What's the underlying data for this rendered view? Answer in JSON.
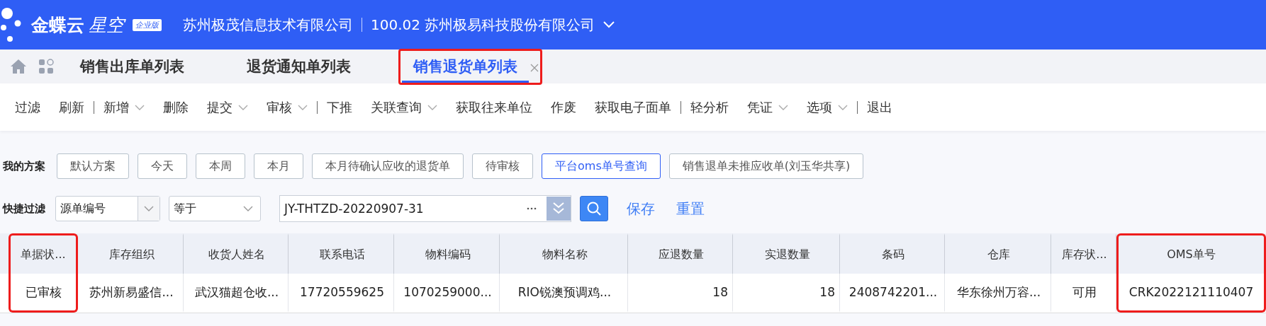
{
  "header": {
    "logo_text": "金蝶云",
    "logo_subtext": "星空",
    "edition_badge": "企业版",
    "company": "苏州极茂信息技术有限公司",
    "org": "100.02 苏州极易科技股份有限公司"
  },
  "tabs": [
    {
      "label": "销售出库单列表",
      "selected": false,
      "highlighted": false,
      "closable": false
    },
    {
      "label": "退货通知单列表",
      "selected": false,
      "highlighted": false,
      "closable": false
    },
    {
      "label": "销售退货单列表",
      "selected": true,
      "highlighted": true,
      "closable": true
    }
  ],
  "toolbar": [
    {
      "label": "过滤",
      "dropdown": false,
      "separator_after": false
    },
    {
      "label": "刷新",
      "dropdown": false,
      "separator_after": true
    },
    {
      "label": "新增",
      "dropdown": true,
      "separator_after": false
    },
    {
      "label": "删除",
      "dropdown": false,
      "separator_after": false
    },
    {
      "label": "提交",
      "dropdown": true,
      "separator_after": false
    },
    {
      "label": "审核",
      "dropdown": true,
      "separator_after": true
    },
    {
      "label": "下推",
      "dropdown": false,
      "separator_after": false
    },
    {
      "label": "关联查询",
      "dropdown": true,
      "separator_after": false
    },
    {
      "label": "获取往来单位",
      "dropdown": false,
      "separator_after": false
    },
    {
      "label": "作废",
      "dropdown": false,
      "separator_after": false
    },
    {
      "label": "获取电子面单",
      "dropdown": false,
      "separator_after": true
    },
    {
      "label": "轻分析",
      "dropdown": false,
      "separator_after": false
    },
    {
      "label": "凭证",
      "dropdown": true,
      "separator_after": false
    },
    {
      "label": "选项",
      "dropdown": true,
      "separator_after": true
    },
    {
      "label": "退出",
      "dropdown": false,
      "separator_after": false
    }
  ],
  "schemes": {
    "label": "我的方案",
    "items": [
      {
        "label": "默认方案",
        "selected": false
      },
      {
        "label": "今天",
        "selected": false
      },
      {
        "label": "本周",
        "selected": false
      },
      {
        "label": "本月",
        "selected": false
      },
      {
        "label": "本月待确认应收的退货单",
        "selected": false
      },
      {
        "label": "待审核",
        "selected": false
      },
      {
        "label": "平台oms单号查询",
        "selected": true
      },
      {
        "label": "销售退单未推应收单(刘玉华共享)",
        "selected": false
      }
    ]
  },
  "quick_filter": {
    "label": "快捷过滤",
    "field": "源单编号",
    "operator": "等于",
    "value": "JY-THTZD-20220907-31",
    "save": "保存",
    "reset": "重置"
  },
  "table": {
    "columns": [
      {
        "label": "单据状...",
        "numeric": false,
        "highlighted": true
      },
      {
        "label": "库存组织",
        "numeric": false,
        "highlighted": false
      },
      {
        "label": "收货人姓名",
        "numeric": false,
        "highlighted": false
      },
      {
        "label": "联系电话",
        "numeric": false,
        "highlighted": false
      },
      {
        "label": "物料编码",
        "numeric": false,
        "highlighted": false
      },
      {
        "label": "物料名称",
        "numeric": false,
        "highlighted": false
      },
      {
        "label": "应退数量",
        "numeric": true,
        "highlighted": false
      },
      {
        "label": "实退数量",
        "numeric": true,
        "highlighted": false
      },
      {
        "label": "条码",
        "numeric": false,
        "highlighted": false
      },
      {
        "label": "仓库",
        "numeric": false,
        "highlighted": false
      },
      {
        "label": "库存状...",
        "numeric": false,
        "highlighted": false
      },
      {
        "label": "OMS单号",
        "numeric": false,
        "highlighted": true
      }
    ],
    "rows": [
      [
        "已审核",
        "苏州新易盛信...",
        "武汉猫超仓收...",
        "17720559625",
        "1070259000...",
        "RIO锐澳预调鸡...",
        "18",
        "18",
        "2408742201...",
        "华东徐州万容...",
        "可用",
        "CRK2022121110407"
      ]
    ]
  }
}
